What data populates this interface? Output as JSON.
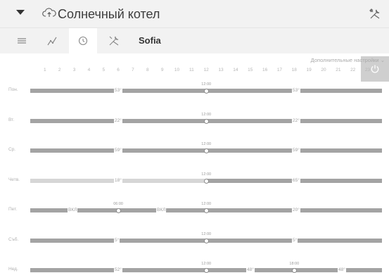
{
  "header": {
    "title": "Солнечный котел"
  },
  "toolbar": {
    "device_name": "Sofia",
    "extra_settings": "Дополнительные настройки ⌄"
  },
  "schedule": {
    "hours": [
      "1",
      "2",
      "3",
      "4",
      "5",
      "6",
      "7",
      "8",
      "9",
      "10",
      "11",
      "12",
      "13",
      "14",
      "15",
      "16",
      "17",
      "18",
      "19",
      "20",
      "21",
      "22",
      "23"
    ],
    "days": [
      {
        "label": "Пон.",
        "segments": [
          {
            "label": "53°"
          },
          {
            "label": "53°"
          }
        ],
        "markers": [
          {
            "time": "12:00"
          }
        ]
      },
      {
        "label": "Вт.",
        "segments": [
          {
            "label": "22°"
          },
          {
            "label": "22°"
          }
        ],
        "markers": [
          {
            "time": "12:00"
          }
        ]
      },
      {
        "label": "Ср.",
        "segments": [
          {
            "label": "59°"
          },
          {
            "label": "59°"
          }
        ],
        "markers": [
          {
            "time": "12:00"
          }
        ]
      },
      {
        "label": "Четв.",
        "segments": [
          {
            "label": "18°"
          },
          {
            "label": "65°"
          }
        ],
        "markers": [
          {
            "time": "12:00"
          }
        ]
      },
      {
        "label": "Пет.",
        "segments": [
          {
            "label": "ВКЛ"
          },
          {
            "label": "ВКЛ"
          },
          {
            "label": "20°"
          }
        ],
        "markers": [
          {
            "time": "06:00"
          },
          {
            "time": "12:00"
          }
        ]
      },
      {
        "label": "Съб.",
        "segments": [
          {
            "label": "5°"
          },
          {
            "label": "5°"
          }
        ],
        "markers": [
          {
            "time": "12:00"
          }
        ]
      },
      {
        "label": "Нед.",
        "segments": [
          {
            "label": "52°"
          },
          {
            "label": "48°"
          },
          {
            "label": "48°"
          }
        ],
        "markers": [
          {
            "time": "12:00"
          },
          {
            "time": "18:00"
          }
        ]
      }
    ]
  }
}
